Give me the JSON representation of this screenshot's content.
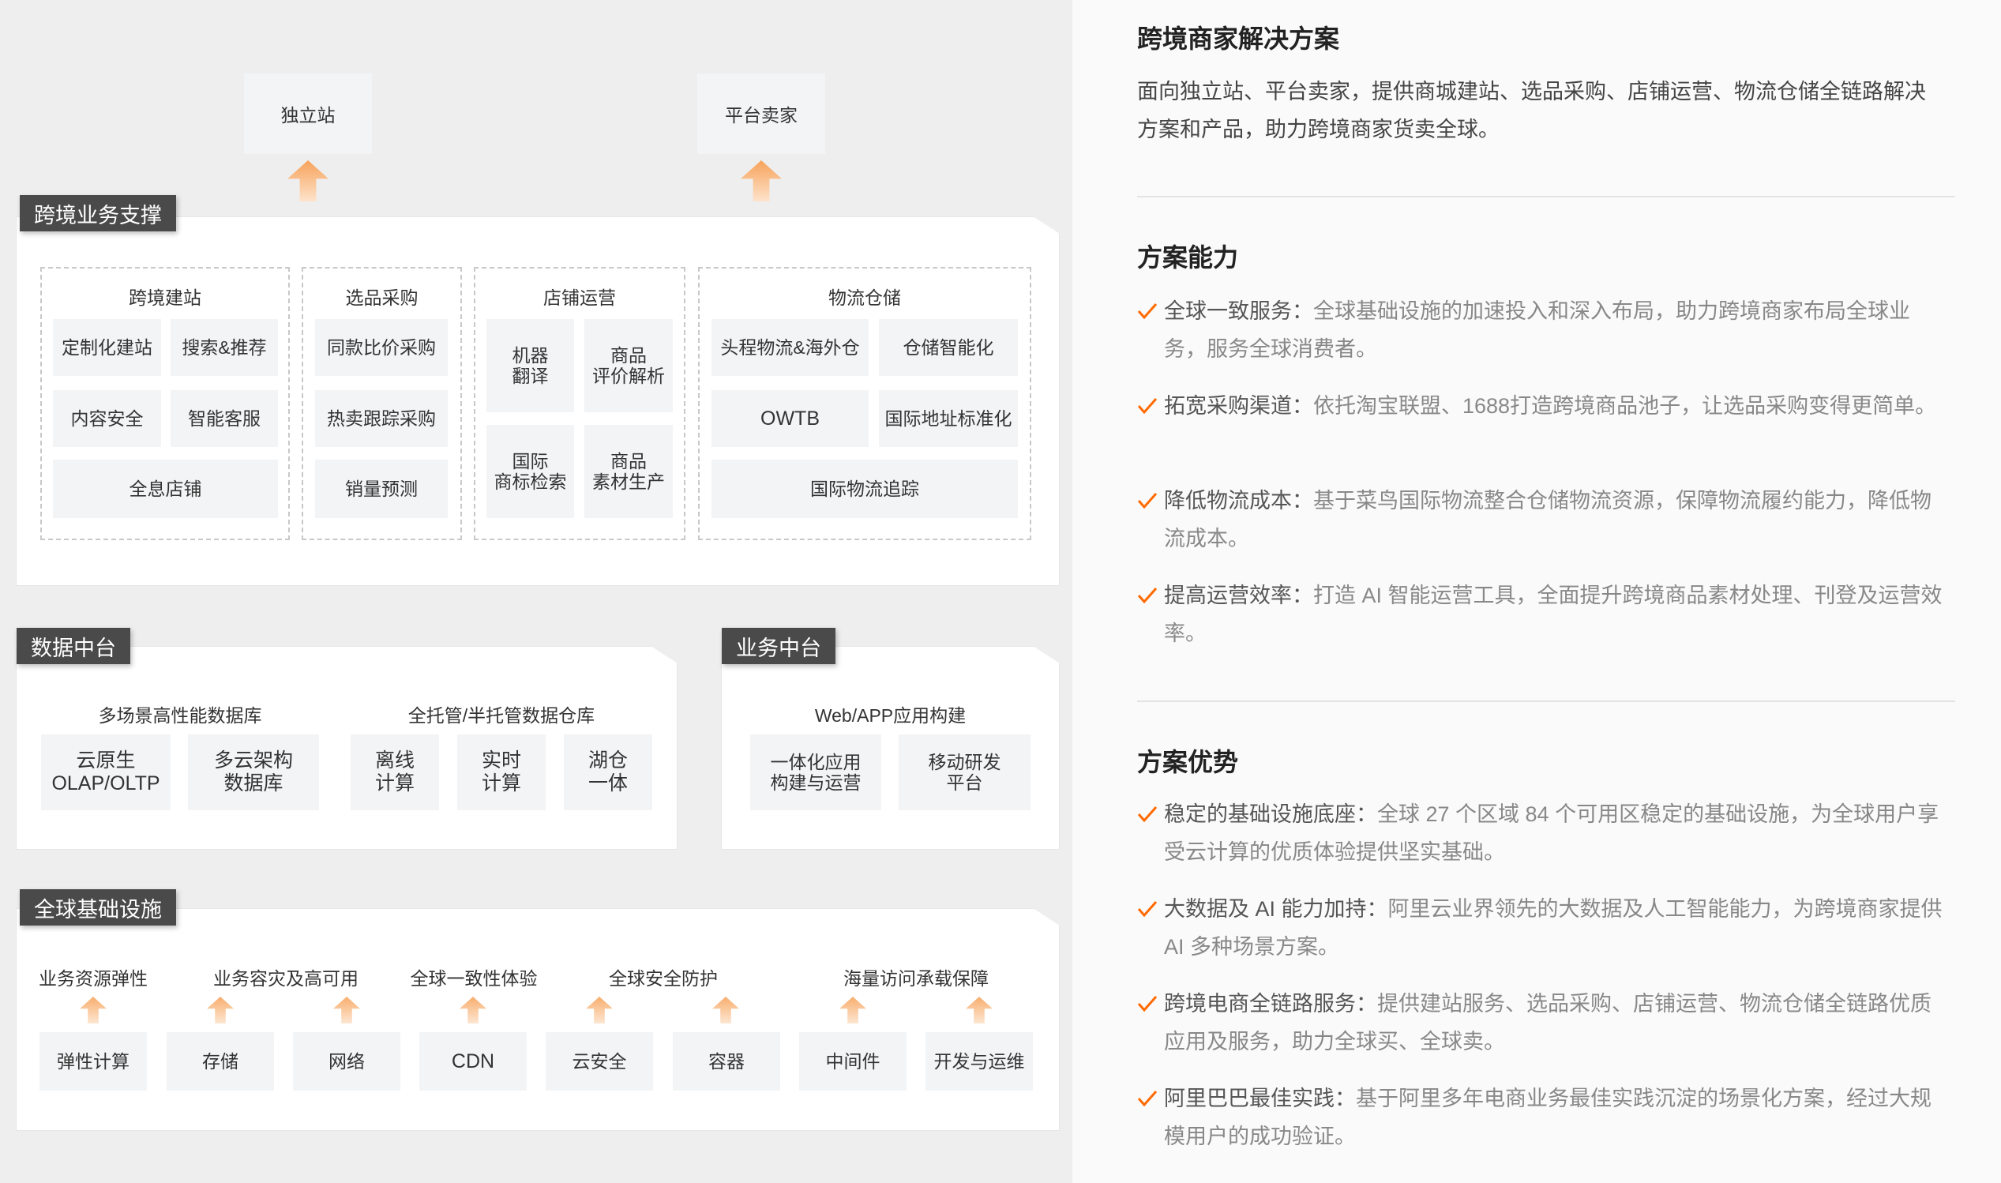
{
  "top": {
    "independent_site": "独立站",
    "platform_seller": "平台卖家"
  },
  "cross_border": {
    "label": "跨境业务支撑",
    "site_building": {
      "title": "跨境建站",
      "items": [
        "定制化建站",
        "搜索&推荐",
        "内容安全",
        "智能客服",
        "全息店铺"
      ]
    },
    "procurement": {
      "title": "选品采购",
      "items": [
        "同款比价采购",
        "热卖跟踪采购",
        "销量预测"
      ]
    },
    "store_ops": {
      "title": "店铺运营",
      "items": [
        "机器\n翻译",
        "商品\n评价解析",
        "国际\n商标检索",
        "商品\n素材生产"
      ]
    },
    "logistics": {
      "title": "物流仓储",
      "items": [
        "头程物流&海外仓",
        "仓储智能化",
        "OWTB",
        "国际地址标准化",
        "国际物流追踪"
      ]
    }
  },
  "data_platform": {
    "label": "数据中台",
    "db_title": "多场景高性能数据库",
    "db_items": [
      "云原生\nOLAP/OLTP",
      "多云架构\n数据库"
    ],
    "warehouse_title": "全托管/半托管数据仓库",
    "warehouse_items": [
      "离线\n计算",
      "实时\n计算",
      "湖仓\n一体"
    ]
  },
  "business_platform": {
    "label": "业务中台",
    "title": "Web/APP应用构建",
    "items": [
      "一体化应用\n构建与运营",
      "移动研发\n平台"
    ]
  },
  "infra": {
    "label": "全球基础设施",
    "headers": [
      "业务资源弹性",
      "业务容灾及高可用",
      "全球一致性体验",
      "全球安全防护",
      "海量访问承载保障"
    ],
    "items": [
      "弹性计算",
      "存储",
      "网络",
      "CDN",
      "云安全",
      "容器",
      "中间件",
      "开发与运维"
    ]
  },
  "right": {
    "title": "跨境商家解决方案",
    "desc": "面向独立站、平台卖家，提供商城建站、选品采购、店铺运营、物流仓储全链路解决方案和产品，助力跨境商家货卖全球。",
    "capability_title": "方案能力",
    "capabilities": [
      {
        "lead": "全球一致服务：",
        "text": "全球基础设施的加速投入和深入布局，助力跨境商家布局全球业务，服务全球消费者。"
      },
      {
        "lead": "拓宽采购渠道：",
        "text": "依托淘宝联盟、1688打造跨境商品池子，让选品采购变得更简单。"
      },
      {
        "lead": "降低物流成本：",
        "text": "基于菜鸟国际物流整合仓储物流资源，保障物流履约能力，降低物流成本。"
      },
      {
        "lead": "提高运营效率：",
        "text": "打造 AI 智能运营工具，全面提升跨境商品素材处理、刊登及运营效率。"
      }
    ],
    "advantage_title": "方案优势",
    "advantages": [
      {
        "lead": "稳定的基础设施底座：",
        "text": "全球 27 个区域 84 个可用区稳定的基础设施，为全球用户享受云计算的优质体验提供坚实基础。"
      },
      {
        "lead": "大数据及 AI 能力加持：",
        "text": "阿里云业界领先的大数据及人工智能能力，为跨境商家提供 AI 多种场景方案。"
      },
      {
        "lead": "跨境电商全链路服务：",
        "text": "提供建站服务、选品采购、店铺运营、物流仓储全链路优质应用及服务，助力全球买、全球卖。"
      },
      {
        "lead": "阿里巴巴最佳实践：",
        "text": "基于阿里多年电商业务最佳实践沉淀的场景化方案，经过大规模用户的成功验证。"
      }
    ],
    "accent_color": "#ff6a00"
  }
}
